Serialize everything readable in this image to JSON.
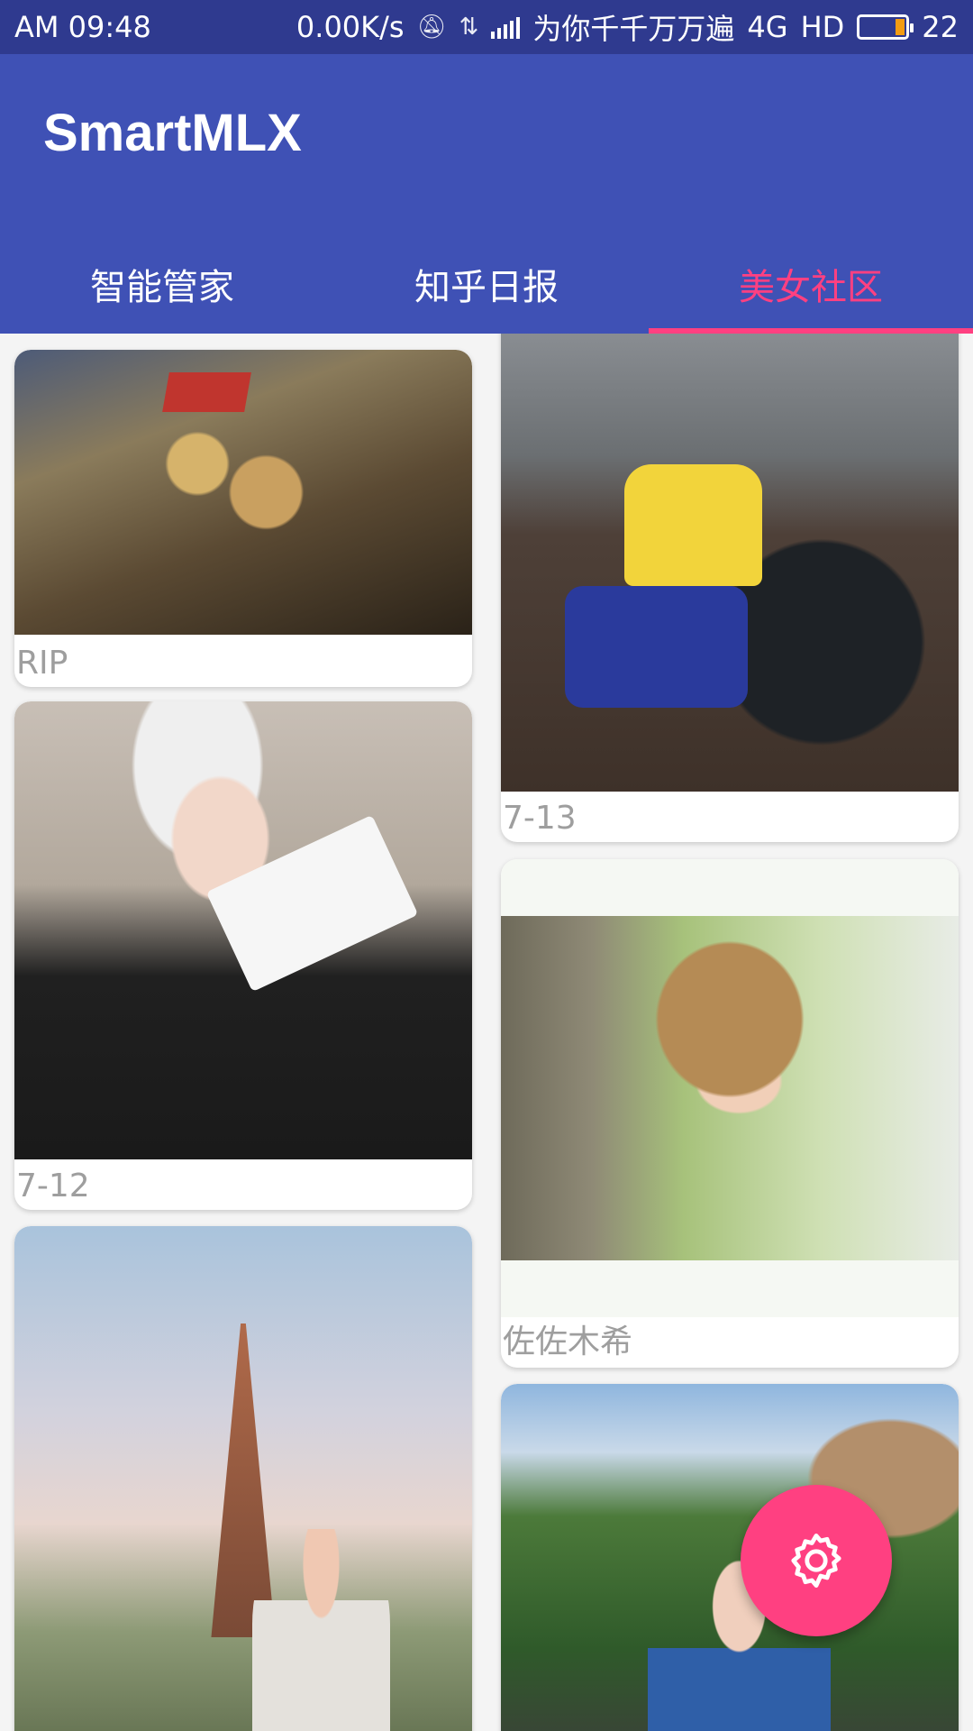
{
  "status_bar": {
    "time": "AM  09:48",
    "speed": "0.00K/s",
    "carrier": "为你千千万万遍",
    "network": "4G",
    "hd": "HD",
    "battery": "22",
    "icons": [
      "mute-bell-icon",
      "data-arrows-icon",
      "signal-icon",
      "battery-icon"
    ]
  },
  "app": {
    "title": "SmartMLX"
  },
  "tabs": [
    {
      "label": "智能管家",
      "active": false
    },
    {
      "label": "知乎日报",
      "active": false
    },
    {
      "label": "美女社区",
      "active": true
    }
  ],
  "colors": {
    "primary": "#3f51b5",
    "primary_dark": "#2f3a8f",
    "accent": "#ff4081",
    "caption": "#9e9e9e"
  },
  "feed": {
    "left_column": [
      {
        "caption": "RIP"
      },
      {
        "caption": "7-12"
      },
      {
        "caption": ""
      }
    ],
    "right_column": [
      {
        "caption": "7-13"
      },
      {
        "caption": "佐佐木希"
      },
      {
        "caption": ""
      }
    ]
  },
  "fab": {
    "icon": "gear-icon"
  }
}
